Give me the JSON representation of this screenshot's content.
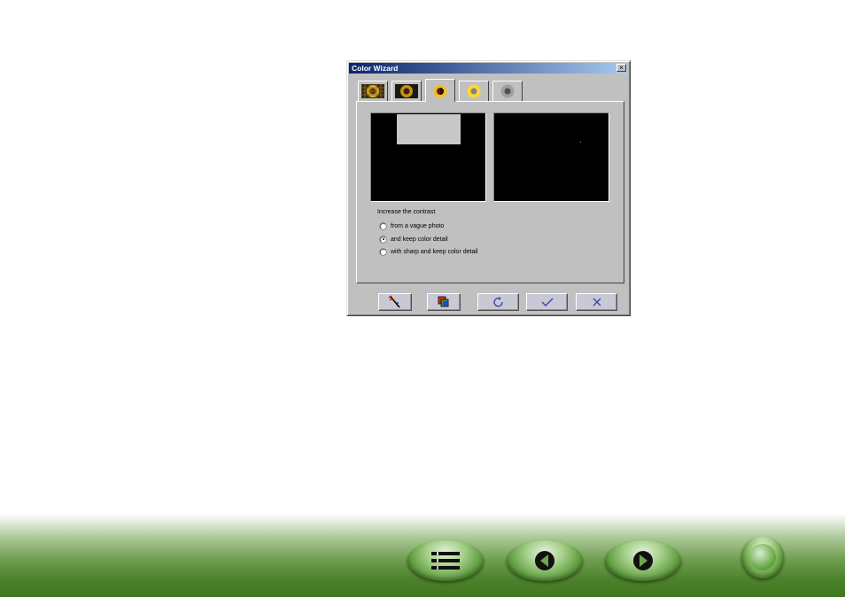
{
  "dialog": {
    "title": "Color Wizard",
    "close_glyph": "×",
    "tabs": [
      {
        "icon": "sunflower-grid-icon",
        "active": false
      },
      {
        "icon": "sunflower-dark-icon",
        "active": false
      },
      {
        "icon": "sunflower-contrast-icon",
        "active": true
      },
      {
        "icon": "sunflower-bright-icon",
        "active": false
      },
      {
        "icon": "sunflower-gray-icon",
        "active": false
      }
    ],
    "options_label": "Increase the contrast",
    "options": [
      {
        "label": "from a vague photo",
        "checked": false
      },
      {
        "label": "and keep color detail",
        "checked": true
      },
      {
        "label": "with sharp and keep color detail",
        "checked": false
      }
    ],
    "buttons": [
      {
        "icon": "magic-wand-icon"
      },
      {
        "icon": "color-layers-icon"
      },
      {
        "icon": "reset-icon"
      },
      {
        "icon": "checkmark-icon"
      },
      {
        "icon": "close-x-icon"
      }
    ]
  },
  "footer_nav": {
    "buttons": [
      {
        "icon": "contents-list-icon"
      },
      {
        "icon": "previous-page-icon"
      },
      {
        "icon": "next-page-icon"
      },
      {
        "icon": "home-circle-icon"
      }
    ]
  },
  "colors": {
    "dialog_face": "#c0c0c0",
    "titlebar_start": "#0a246a",
    "titlebar_end": "#a6caf0",
    "preview_bg": "#000000",
    "footer_green": "#4b8129"
  }
}
